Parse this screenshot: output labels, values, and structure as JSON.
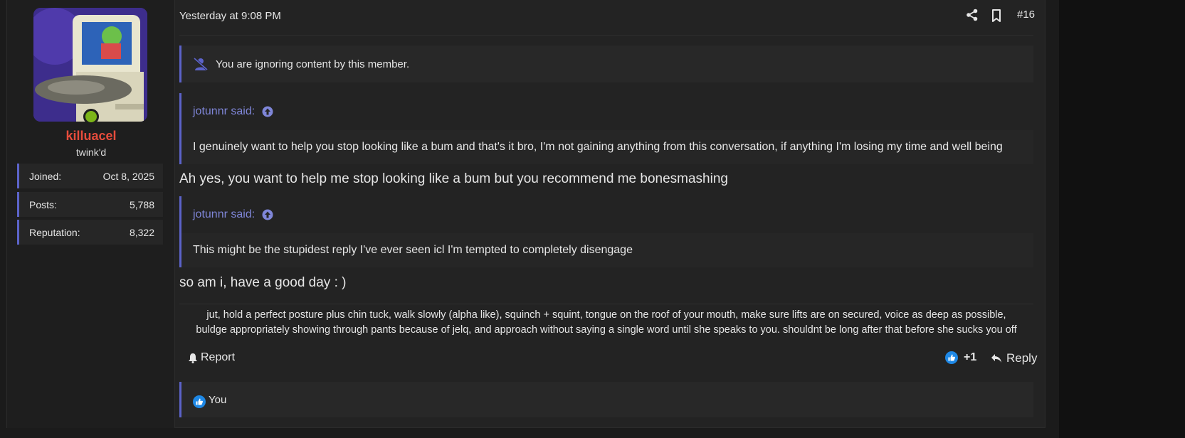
{
  "post": {
    "date": "Yesterday at 9:08 PM",
    "number": "#16"
  },
  "user": {
    "name": "killuacel",
    "title": "twink'd",
    "stats": [
      {
        "label": "Joined:",
        "value": "Oct 8, 2025"
      },
      {
        "label": "Posts:",
        "value": "5,788"
      },
      {
        "label": "Reputation:",
        "value": "8,322"
      }
    ]
  },
  "ignore_notice": "You are ignoring content by this member.",
  "quotes": [
    {
      "author": "jotunnr said:",
      "text": "I genuinely want to help you stop looking like a bum and that's it bro, I'm not gaining anything from this conversation, if anything I'm losing my time and well being"
    },
    {
      "author": "jotunnr said:",
      "text": "This might be the stupidest reply I've ever seen icl I'm tempted to completely disengage"
    }
  ],
  "replies": [
    "Ah yes, you want to help me stop looking like a bum but you recommend me bonesmashing",
    "so am i, have a good day : )"
  ],
  "signature": {
    "line1": "jut, hold a perfect posture plus chin tuck, walk slowly (alpha like), squinch + squint, tongue on the roof of your mouth, make sure lifts are on secured, voice as deep as possible,",
    "line2": "buldge appropriately showing through pants because of jelq, and approach without saying a single word until she speaks to you. shouldnt be long after that before she sucks you off"
  },
  "actions": {
    "report": "Report",
    "like_count": "+1",
    "reply": "Reply"
  },
  "reactions": {
    "list": "You"
  },
  "colors": {
    "username": "#e74c3c",
    "accent": "#5c63c9",
    "quote_author": "#7f86d8",
    "like_blue": "#1e88e5",
    "online": "#7cb518"
  },
  "icons": {
    "share": "share-icon",
    "bookmark": "bookmark-icon",
    "ignore": "muted-user-icon",
    "quote_jump": "arrow-up-circle-icon",
    "report": "bell-icon",
    "like": "thumbs-up-icon",
    "reply": "reply-icon"
  }
}
